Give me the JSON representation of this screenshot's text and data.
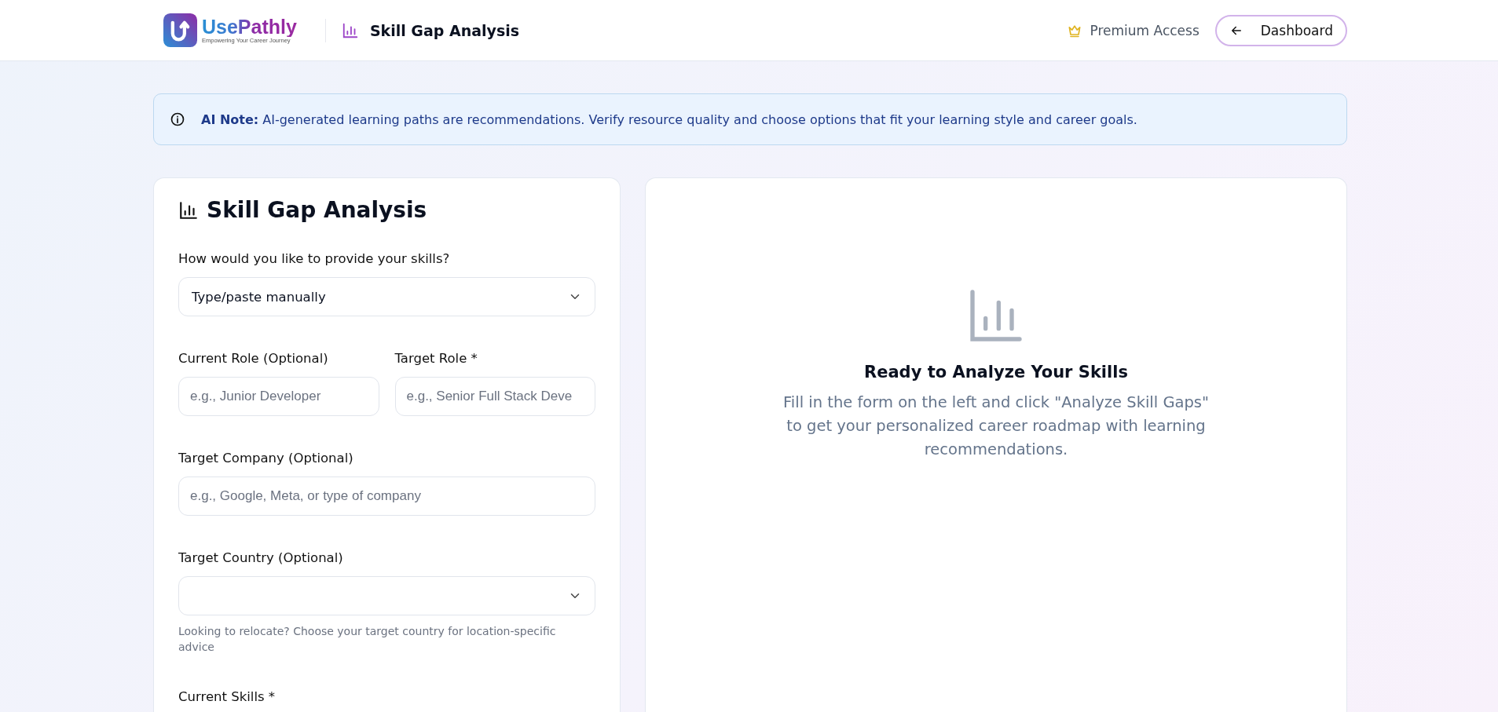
{
  "header": {
    "brand": "UsePathly",
    "tagline": "Empowering Your Career Journey",
    "page_title": "Skill Gap Analysis",
    "premium": "Premium Access",
    "back_button": "Dashboard"
  },
  "note": {
    "label": "AI Note:",
    "text": "AI-generated learning paths are recommendations. Verify resource quality and choose options that fit your learning style and career goals."
  },
  "form": {
    "title": "Skill Gap Analysis",
    "fields": [
      {
        "kind": "select",
        "label": "How would you like to provide your skills?",
        "value": "Type/paste manually"
      },
      {
        "kind": "pair",
        "items": [
          {
            "label": "Current Role (Optional)",
            "placeholder": "e.g., Junior Developer"
          },
          {
            "label": "Target Role *",
            "placeholder": "e.g., Senior Full Stack Deve"
          }
        ]
      },
      {
        "kind": "input",
        "label": "Target Company (Optional)",
        "placeholder": "e.g., Google, Meta, or type of company"
      },
      {
        "kind": "select",
        "label": "Target Country (Optional)",
        "hint": "Looking to relocate? Choose your target country for location-specific advice"
      },
      {
        "kind": "textarea",
        "label": "Current Skills *"
      }
    ]
  },
  "empty_state": {
    "title": "Ready to Analyze Your Skills",
    "text": "Fill in the form on the left and click \"Analyze Skill Gaps\" to get your personalized career roadmap with learning recommendations."
  }
}
